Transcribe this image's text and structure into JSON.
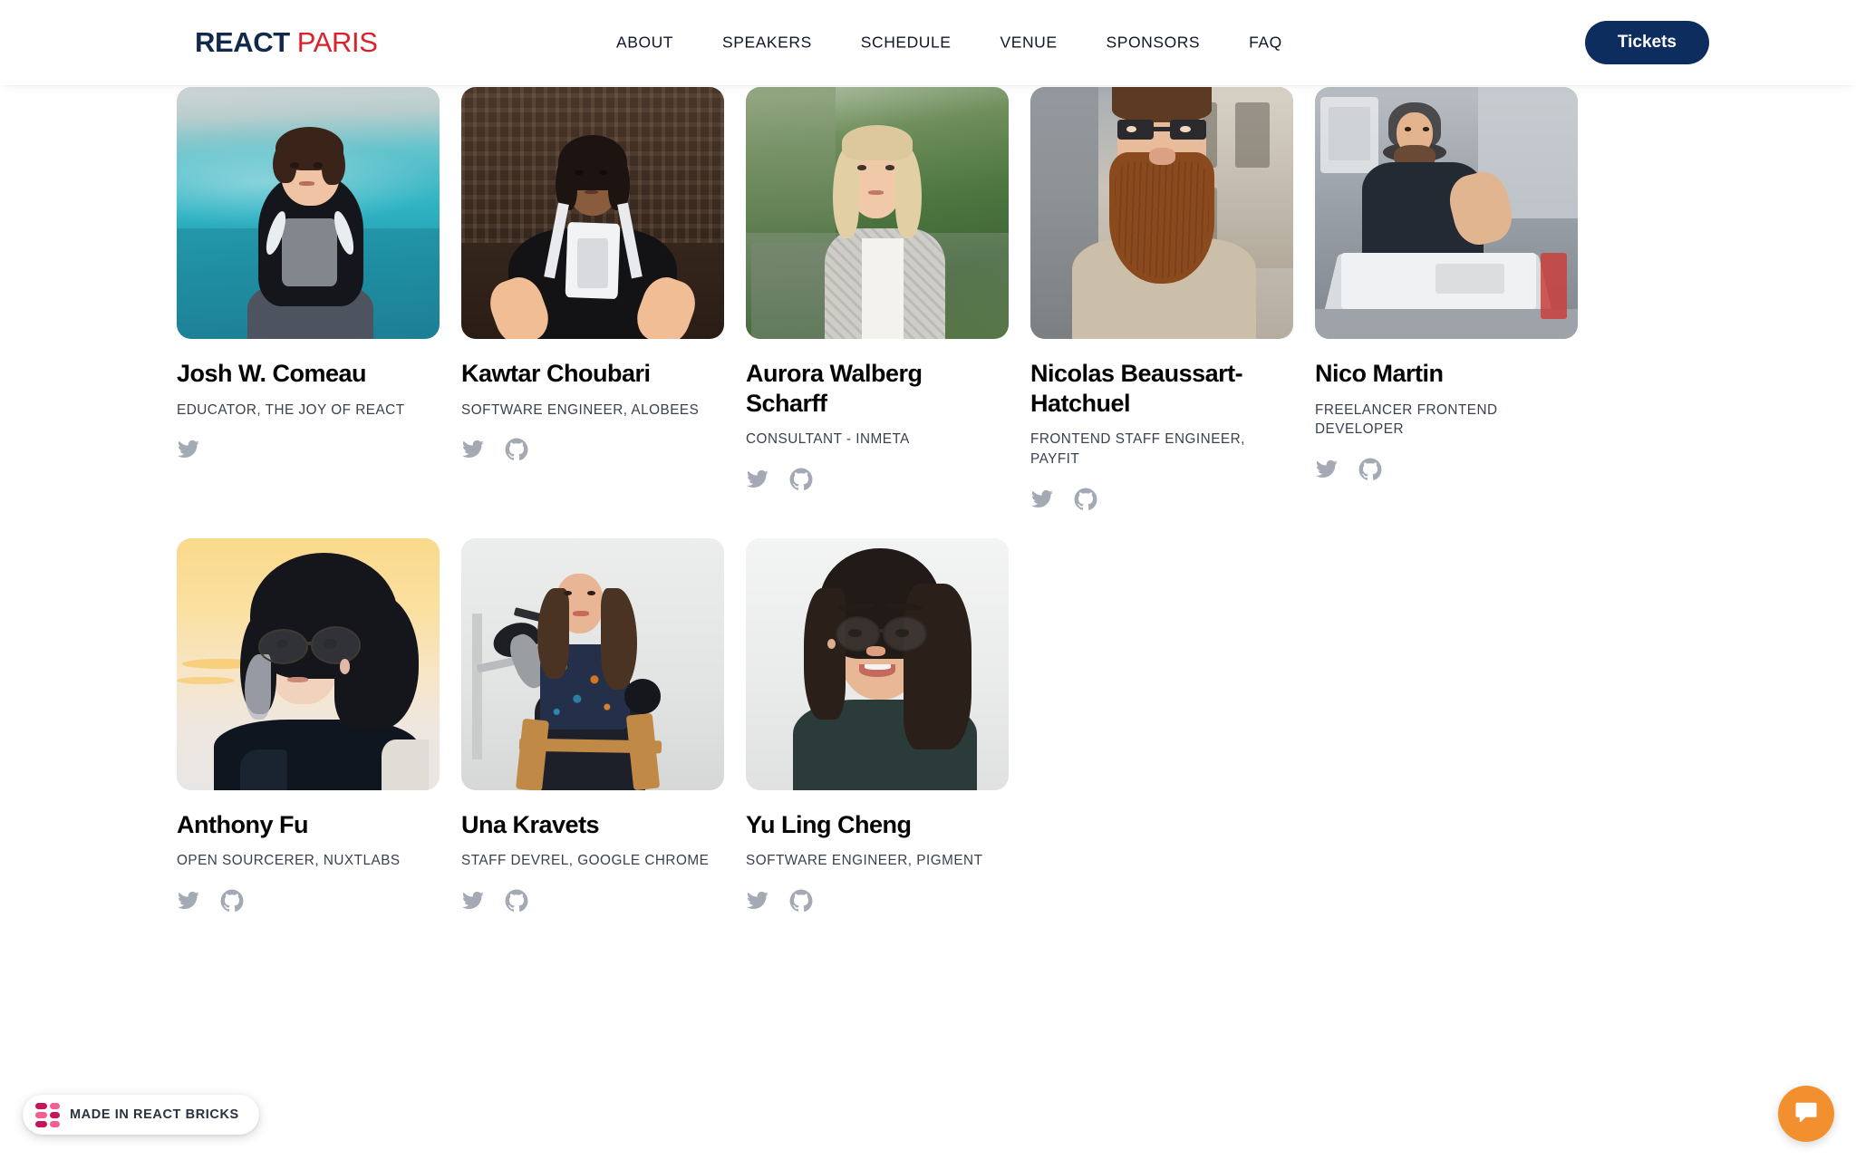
{
  "header": {
    "logo": {
      "primary": "REACT",
      "secondary": "PARIS",
      "primary_color": "#11294d",
      "secondary_color": "#d8232a"
    },
    "nav": [
      {
        "label": "ABOUT"
      },
      {
        "label": "SPEAKERS"
      },
      {
        "label": "SCHEDULE"
      },
      {
        "label": "VENUE"
      },
      {
        "label": "SPONSORS"
      },
      {
        "label": "FAQ"
      }
    ],
    "cta": {
      "label": "Tickets",
      "bg_color": "#0d2d5e",
      "text_color": "#ffffff"
    }
  },
  "speakers": [
    {
      "name": "Josh W. Comeau",
      "role": "EDUCATOR, THE JOY OF REACT",
      "socials": [
        "twitter-icon"
      ]
    },
    {
      "name": "Kawtar Choubari",
      "role": "SOFTWARE ENGINEER, ALOBEES",
      "socials": [
        "twitter-icon",
        "github-icon"
      ]
    },
    {
      "name": "Aurora Walberg Scharff",
      "role": "CONSULTANT - INMETA",
      "socials": [
        "twitter-icon",
        "github-icon"
      ]
    },
    {
      "name": "Nicolas Beaussart-Hatchuel",
      "role": "FRONTEND STAFF ENGINEER, PAYFIT",
      "socials": [
        "twitter-icon",
        "github-icon"
      ]
    },
    {
      "name": "Nico Martin",
      "role": "FREELANCER FRONTEND DEVELOPER",
      "socials": [
        "twitter-icon",
        "github-icon"
      ]
    },
    {
      "name": "Anthony Fu",
      "role": "OPEN SOURCERER, NUXTLABS",
      "socials": [
        "twitter-icon",
        "github-icon"
      ]
    },
    {
      "name": "Una Kravets",
      "role": "STAFF DEVREL, GOOGLE CHROME",
      "socials": [
        "twitter-icon",
        "github-icon"
      ]
    },
    {
      "name": "Yu Ling Cheng",
      "role": "SOFTWARE ENGINEER, PIGMENT",
      "socials": [
        "twitter-icon",
        "github-icon"
      ]
    }
  ],
  "badge": {
    "label": "MADE IN REACT BRICKS",
    "colors": {
      "dark": "#c2185b",
      "light": "#f45f93"
    }
  },
  "chat": {
    "icon": "chat-bubble-icon",
    "bg_color": "#f2902f"
  }
}
